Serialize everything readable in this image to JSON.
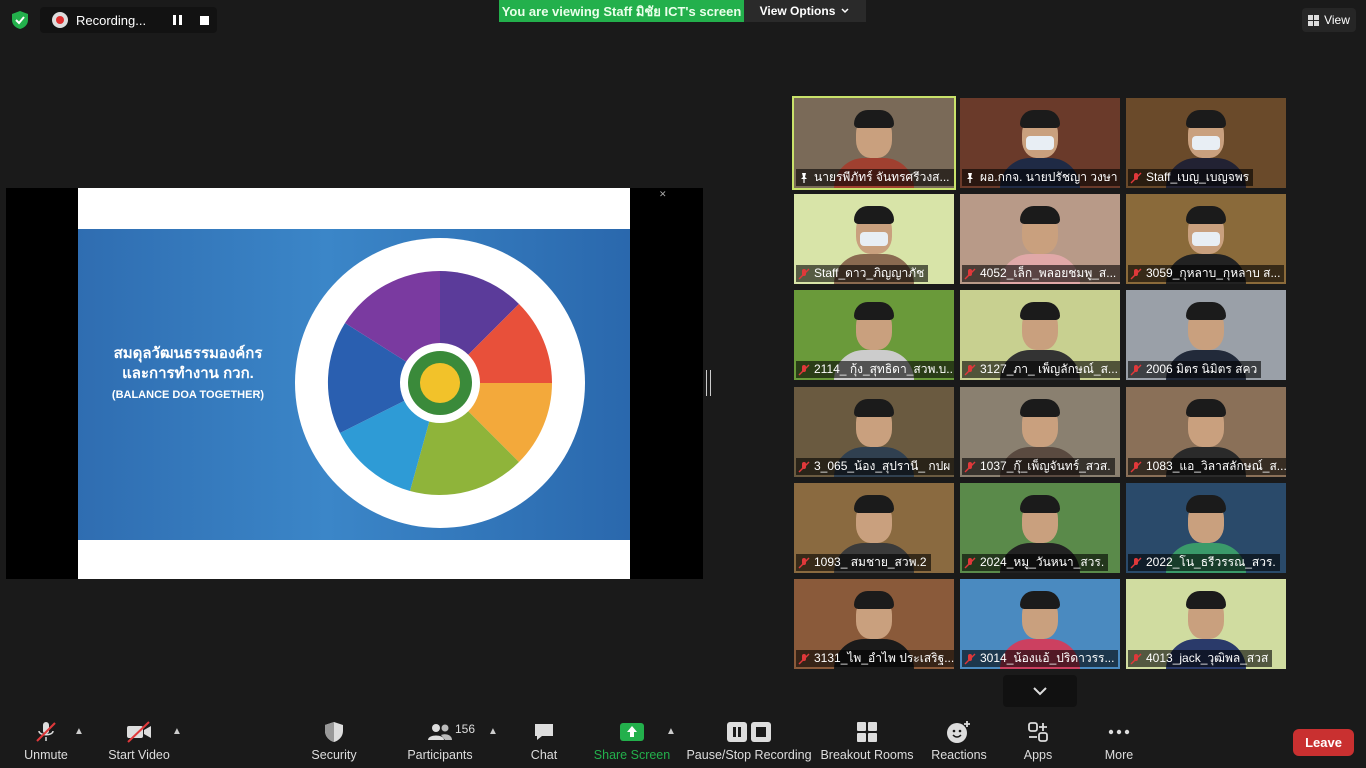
{
  "top": {
    "recording_label": "Recording...",
    "viewing_banner": "You are viewing Staff มิชัย ICT's screen",
    "view_options": "View Options",
    "view_button": "View"
  },
  "slide": {
    "title_line1": "สมดุลวัฒนธรรมองค์กร",
    "title_line2": "และการทำงาน กวก.",
    "title_line3": "(BALANCE DOA TOGETHER)"
  },
  "gallery": [
    {
      "name": "นายรพีภัทร์ จันทรศรีวงส...",
      "pinned": true,
      "bg": "#7a6a58",
      "shirt": "#a04030",
      "active": true,
      "mask": false
    },
    {
      "name": "ผอ.กกจ. นายปรัชญา วงษา",
      "pinned": true,
      "bg": "#6a3a2a",
      "shirt": "#1f2a45",
      "active": false,
      "mask": true
    },
    {
      "name": "Staff_เบญ_เบญจพร",
      "pinned": false,
      "bg": "#6a4a2a",
      "shirt": "#223",
      "active": false,
      "mask": true
    },
    {
      "name": "Staff_ดาว_ภิญญาภัช",
      "pinned": false,
      "bg": "#d8e4a8",
      "shirt": "#8a6a50",
      "active": false,
      "mask": true
    },
    {
      "name": "4052_เล็ก_พลอยชมพู_ส...",
      "pinned": false,
      "bg": "#b89a88",
      "shirt": "#e0a8a8",
      "active": false,
      "mask": false
    },
    {
      "name": "3059_กุหลาบ_กุหลาบ  ส...",
      "pinned": false,
      "bg": "#8a6a3a",
      "shirt": "#222",
      "active": false,
      "mask": true
    },
    {
      "name": "2114_ กุ้ง_สุทธิดา_สวพ.บ...",
      "pinned": false,
      "bg": "#6a9a3a",
      "shirt": "#ccc",
      "active": false,
      "mask": false
    },
    {
      "name": "3127_ภา_ เพ็ญลักษณ์_ส...",
      "pinned": false,
      "bg": "#c8d090",
      "shirt": "#333",
      "active": false,
      "mask": false
    },
    {
      "name": "2006 มิตร  นิมิตร  สคว",
      "pinned": false,
      "bg": "#9aa0a8",
      "shirt": "#222a3a",
      "active": false,
      "mask": false
    },
    {
      "name": "3_065_น้อง_สุปรานี_ กปผ",
      "pinned": false,
      "bg": "#6a5a40",
      "shirt": "#304050",
      "active": false,
      "mask": false
    },
    {
      "name": "1037_กุ๊_เพ็ญจันทร์_สวส.",
      "pinned": false,
      "bg": "#8a8070",
      "shirt": "#5a4a40",
      "active": false,
      "mask": false
    },
    {
      "name": "1083_แอ_วิลาสลักษณ์_ส...",
      "pinned": false,
      "bg": "#8a7058",
      "shirt": "#2a2a2a",
      "active": false,
      "mask": false
    },
    {
      "name": "1093_ สมชาย_สวพ.2",
      "pinned": false,
      "bg": "#8a6a40",
      "shirt": "#3a3a3a",
      "active": false,
      "mask": false
    },
    {
      "name": "2024_หมู_วันหนา_สวร.",
      "pinned": false,
      "bg": "#5a8a4a",
      "shirt": "#222",
      "active": false,
      "mask": false
    },
    {
      "name": "2022_โน_ธรีวรรณ_สวร.",
      "pinned": false,
      "bg": "#2a4a6a",
      "shirt": "#3a9a6a",
      "active": false,
      "mask": false
    },
    {
      "name": "3131_ไพ_อำไพ ประเสริฐ...",
      "pinned": false,
      "bg": "#8a5a3a",
      "shirt": "#1a1a1a",
      "active": false,
      "mask": false
    },
    {
      "name": "3014_น้องแอ้_ปริดาวรร...",
      "pinned": false,
      "bg": "#4a8ac0",
      "shirt": "#cc4060",
      "active": false,
      "mask": false
    },
    {
      "name": "4013_jack_วุฒิพล_สวส",
      "pinned": false,
      "bg": "#d0dca0",
      "shirt": "#2a3a6a",
      "active": false,
      "mask": false
    }
  ],
  "toolbar": {
    "unmute": "Unmute",
    "start_video": "Start Video",
    "security": "Security",
    "participants": "Participants",
    "participant_count": "156",
    "chat": "Chat",
    "share_screen": "Share Screen",
    "pause_stop": "Pause/Stop Recording",
    "breakout": "Breakout Rooms",
    "reactions": "Reactions",
    "apps": "Apps",
    "more": "More",
    "leave": "Leave"
  },
  "colors": {
    "banner_green": "#23b04c",
    "leave_red": "#c93030",
    "share_green": "#23b04c",
    "active_speaker": "#c9e26a"
  }
}
